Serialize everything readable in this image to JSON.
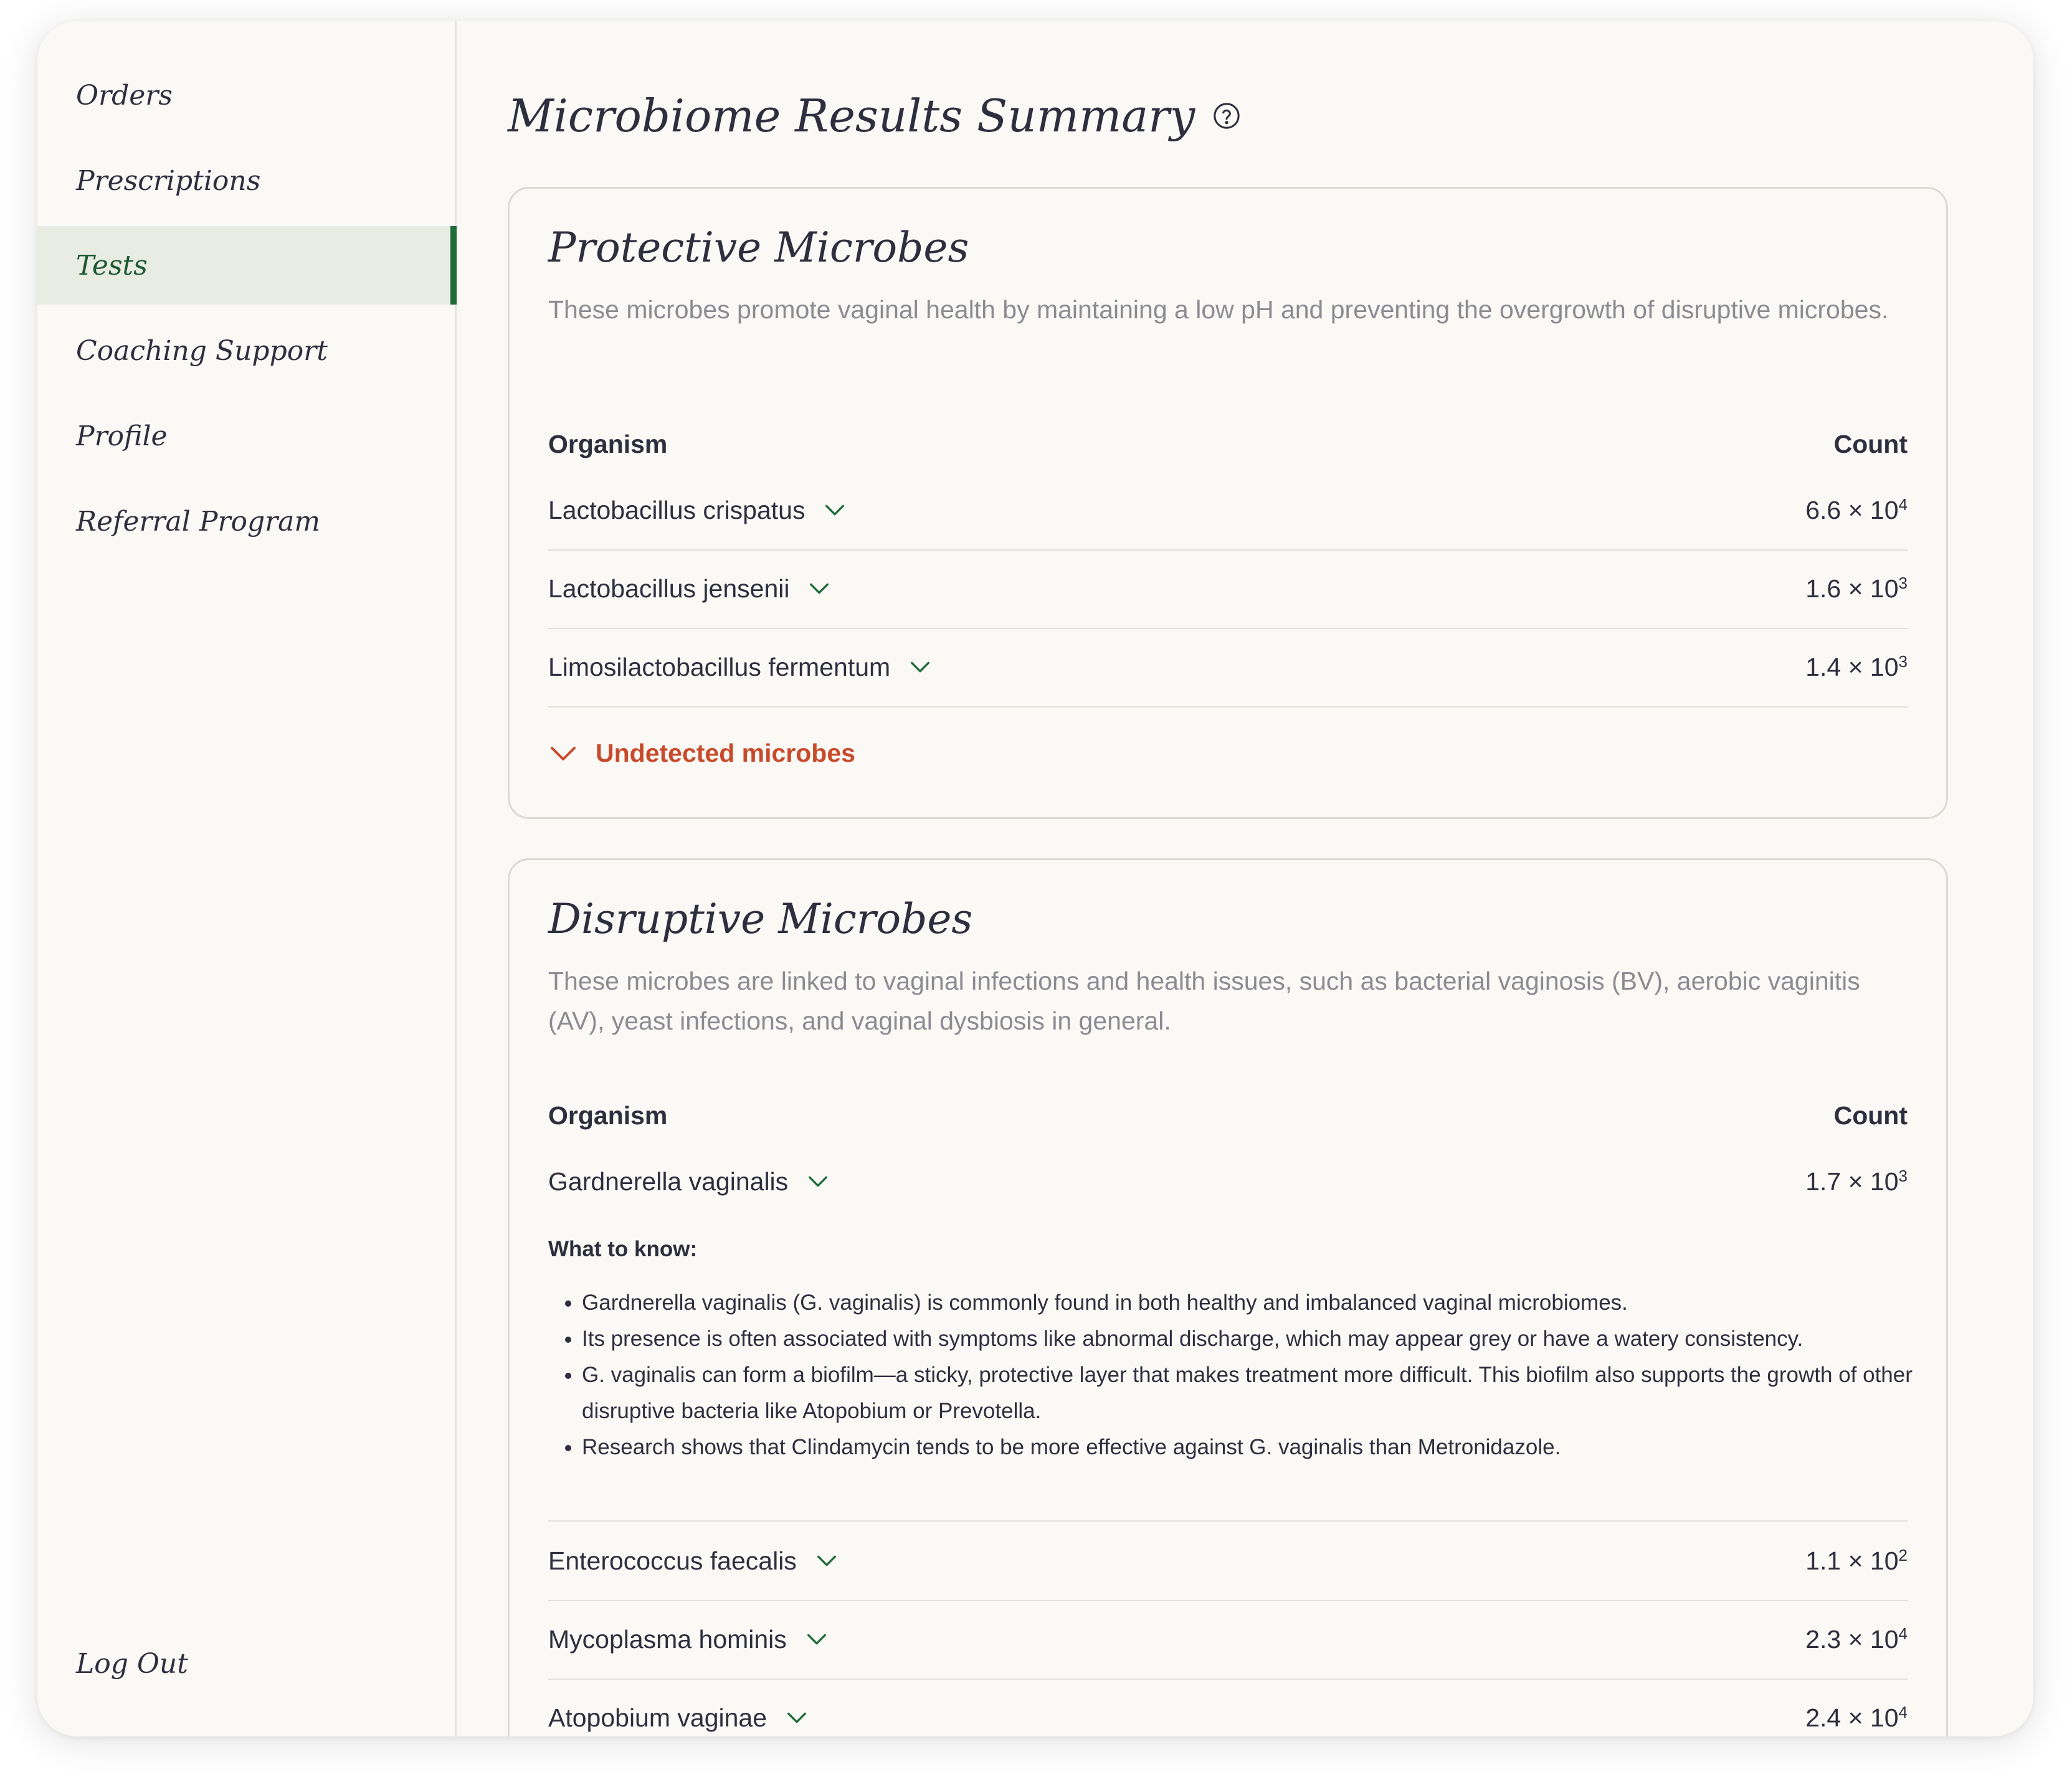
{
  "sidebar": {
    "items": [
      {
        "label": "Orders",
        "active": false
      },
      {
        "label": "Prescriptions",
        "active": false
      },
      {
        "label": "Tests",
        "active": true
      },
      {
        "label": "Coaching Support",
        "active": false
      },
      {
        "label": "Profile",
        "active": false
      },
      {
        "label": "Referral Program",
        "active": false
      }
    ],
    "logout_label": "Log Out"
  },
  "page": {
    "title": "Microbiome Results Summary",
    "help_icon": "question-circle-icon"
  },
  "colors": {
    "accent": "#1f6b3a",
    "active_bg": "#e9ece2",
    "alert": "#c94a2a",
    "muted_text": "#8b8b92"
  },
  "protective": {
    "title": "Protective Microbes",
    "description": "These microbes promote vaginal health by maintaining a low pH and preventing the overgrowth of disruptive microbes.",
    "col_organism": "Organism",
    "col_count": "Count",
    "rows": [
      {
        "name": "Lactobacillus crispatus",
        "mantissa": "6.6 × 10",
        "exp": "4"
      },
      {
        "name": "Lactobacillus jensenii",
        "mantissa": "1.6 × 10",
        "exp": "3"
      },
      {
        "name": "Limosilactobacillus fermentum",
        "mantissa": "1.4 × 10",
        "exp": "3"
      }
    ],
    "undetected_label": "Undetected microbes"
  },
  "disruptive": {
    "title": "Disruptive Microbes",
    "description": "These microbes are linked to vaginal infections and health issues, such as bacterial vaginosis (BV), aerobic vaginitis (AV), yeast infections, and vaginal dysbiosis in general.",
    "col_organism": "Organism",
    "col_count": "Count",
    "expanded": {
      "name": "Gardnerella vaginalis",
      "mantissa": "1.7 × 10",
      "exp": "3",
      "know_title": "What to know:",
      "bullets": [
        "Gardnerella vaginalis (G. vaginalis) is commonly found in both healthy and imbalanced vaginal microbiomes.",
        "Its presence is often associated with symptoms like abnormal discharge, which may appear grey or have a watery consistency.",
        "G. vaginalis can form a biofilm—a sticky, protective layer that makes treatment more difficult. This biofilm also supports the growth of other disruptive bacteria like Atopobium or Prevotella.",
        "Research shows that Clindamycin tends to be more effective against G. vaginalis than Metronidazole."
      ]
    },
    "rows": [
      {
        "name": "Enterococcus faecalis",
        "mantissa": "1.1 × 10",
        "exp": "2"
      },
      {
        "name": "Mycoplasma hominis",
        "mantissa": "2.3 × 10",
        "exp": "4"
      },
      {
        "name": "Atopobium vaginae",
        "mantissa": "2.4 × 10",
        "exp": "4"
      }
    ]
  }
}
